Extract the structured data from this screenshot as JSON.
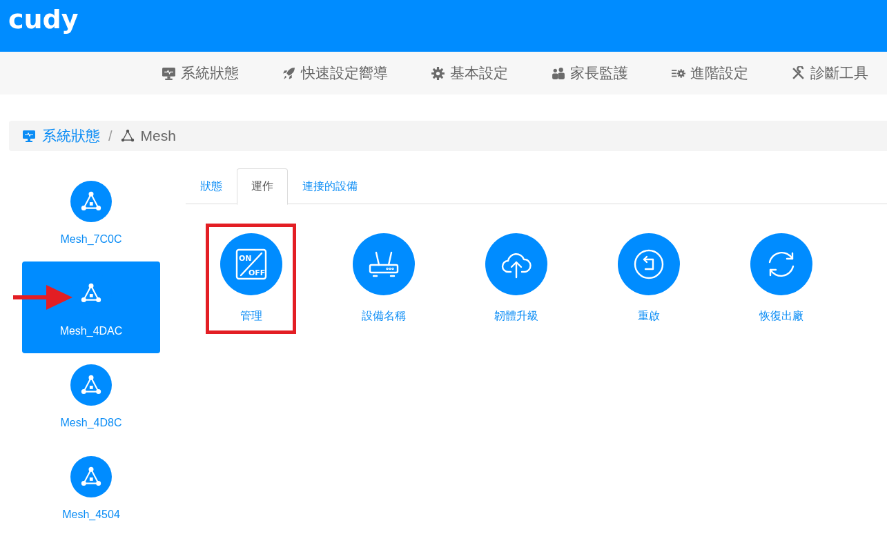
{
  "logo": "cudy",
  "nav": [
    {
      "label": "系統狀態",
      "kind": "monitor"
    },
    {
      "label": "快速設定嚮導",
      "kind": "rocket"
    },
    {
      "label": "基本設定",
      "kind": "gear"
    },
    {
      "label": "家長監護",
      "kind": "users"
    },
    {
      "label": "進階設定",
      "kind": "cogs"
    },
    {
      "label": "診斷工具",
      "kind": "tools"
    }
  ],
  "breadcrumb": {
    "separator": "/",
    "items": [
      {
        "label": "系統狀態",
        "kind": "monitor",
        "current": false
      },
      {
        "label": "Mesh",
        "kind": "mesh",
        "current": true
      }
    ]
  },
  "nodes": [
    {
      "name": "Mesh_7C0C",
      "selected": false,
      "pointed": false
    },
    {
      "name": "Mesh_4DAC",
      "selected": true,
      "pointed": true
    },
    {
      "name": "Mesh_4D8C",
      "selected": false,
      "pointed": false
    },
    {
      "name": "Mesh_4504",
      "selected": false,
      "pointed": false
    }
  ],
  "tabs": [
    {
      "label": "狀態",
      "selected": false
    },
    {
      "label": "運作",
      "selected": true
    },
    {
      "label": "連接的設備",
      "selected": false
    }
  ],
  "actions": [
    {
      "label": "管理",
      "kind": "onoff",
      "icon_text": [
        "ON",
        "OFF"
      ],
      "highlighted": true
    },
    {
      "label": "設備名稱",
      "kind": "router",
      "highlighted": false
    },
    {
      "label": "韌體升級",
      "kind": "cloud",
      "highlighted": false
    },
    {
      "label": "重啟",
      "kind": "restart",
      "highlighted": false
    },
    {
      "label": "恢復出廠",
      "kind": "reset",
      "highlighted": false
    }
  ]
}
